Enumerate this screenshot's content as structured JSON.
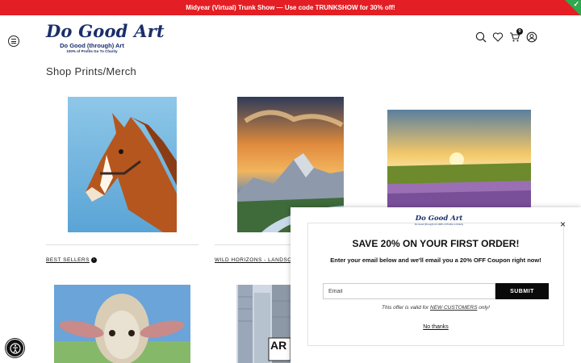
{
  "promo": {
    "text": "Midyear (Virtual) Trunk Show — Use code TRUNKSHOW for 30% off!",
    "check_icon": "check-icon"
  },
  "header": {
    "logo_title": "Do Good Art",
    "logo_subtitle": "Do Good (through) Art",
    "logo_tagline": "100% of Profits Go To Charity",
    "cart_count": "0",
    "icons": [
      "menu-icon",
      "search-icon",
      "heart-icon",
      "cart-icon",
      "account-icon"
    ]
  },
  "page_title": "Shop Prints/Merch",
  "products": [
    {
      "caption": "BEST SELLERS",
      "art": "horse-painting"
    },
    {
      "caption": "WILD HORIZONS - LANDSC",
      "art": "mountain-landscape"
    },
    {
      "caption": "",
      "art": "sunset-field"
    },
    {
      "caption": "",
      "art": "sheep-painting"
    },
    {
      "caption": "",
      "art": "city-buildings",
      "sign_text": "AR"
    }
  ],
  "popup": {
    "logo_title": "Do Good Art",
    "logo_subtitle": "Do Good (through) Art  100% of Profits to Charity",
    "heading": "SAVE 20% ON YOUR FIRST ORDER!",
    "description": "Enter your email below and we'll email you a 20% OFF Coupon right now!",
    "email_placeholder": "Email",
    "submit_label": "SUBMIT",
    "note_prefix": "This offer is valid for ",
    "note_link": "NEW CUSTOMERS",
    "note_suffix": " only!",
    "no_thanks": "No thanks",
    "close_label": "×"
  },
  "colors": {
    "promo_bg": "#e31e24",
    "brand_navy": "#1a2e6b",
    "submit_bg": "#0a0a0a"
  }
}
